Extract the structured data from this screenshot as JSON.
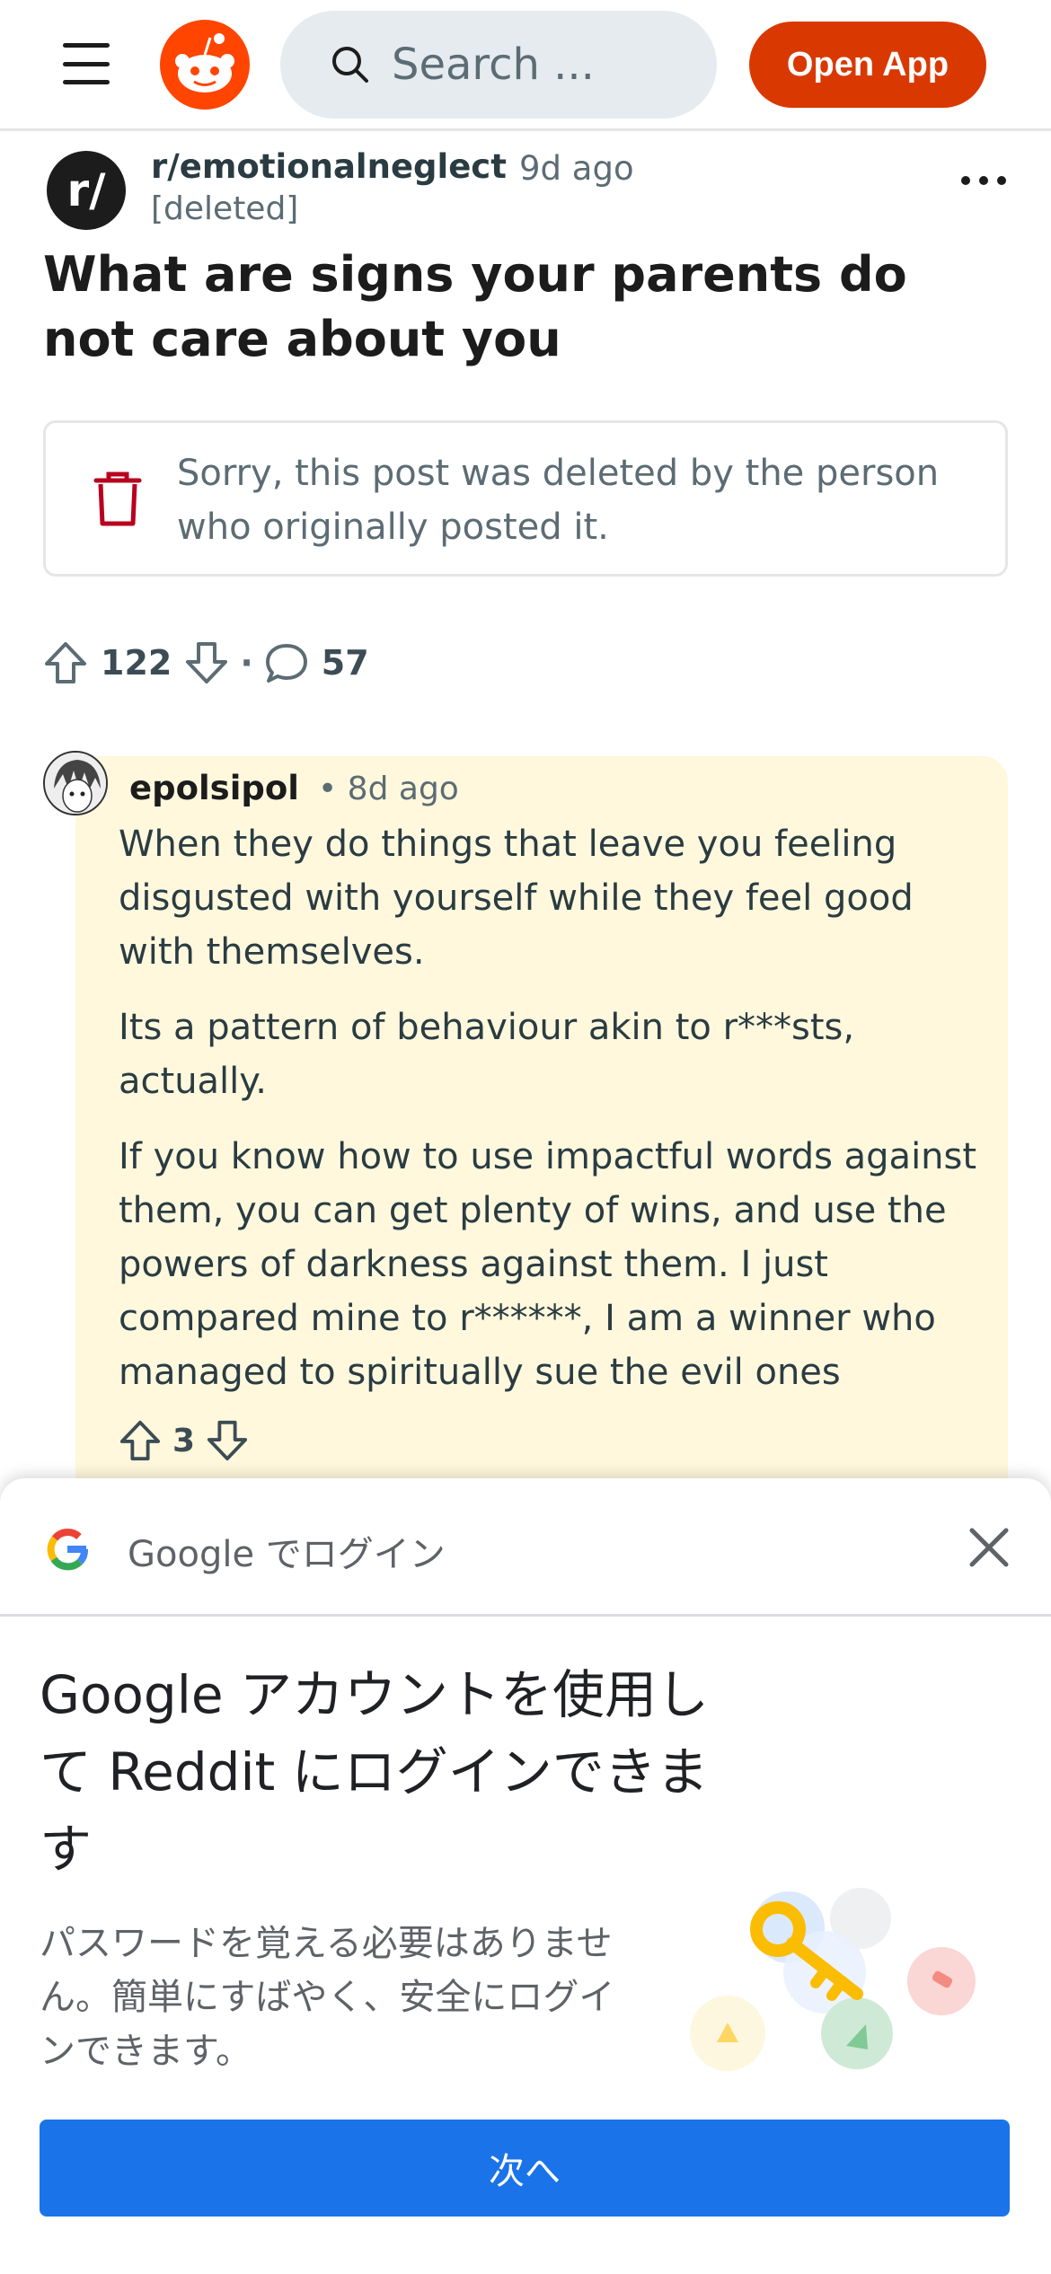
{
  "header": {
    "search_placeholder": "Search ...",
    "open_app_label": "Open App"
  },
  "post": {
    "subreddit_icon_text": "r/",
    "subreddit": "r/emotionalneglect",
    "age": "9d ago",
    "author": "[deleted]",
    "title": "What are signs your parents do not care about you",
    "deleted_notice": "Sorry, this post was deleted by the person who originally posted it.",
    "upvotes": "122",
    "separator": "·",
    "comments": "57"
  },
  "comment": {
    "username": "epolsipol",
    "age": "• 8d ago",
    "paragraphs": [
      "When they do things that leave you feeling disgusted with yourself while they feel good with themselves.",
      "Its a pattern of behaviour akin to r***sts, actually.",
      "If you know how to use impactful words against them, you can get plenty of wins, and use the powers of darkness against them. I just compared mine to r******, I am a winner who managed to spiritually sue the evil ones"
    ],
    "votes": "3"
  },
  "google_sheet": {
    "header_text": "Google でログイン",
    "title": "Google アカウントを使用して Reddit にログインできます",
    "description": "パスワードを覚える必要はありません。簡単にすばやく、安全にログインできます。",
    "next_label": "次へ"
  },
  "colors": {
    "reddit_orange": "#d93900",
    "comment_bg": "#fff8dd",
    "google_blue": "#1a73e8",
    "trash_red": "#b8001f"
  },
  "icons": [
    "menu-icon",
    "reddit-logo-icon",
    "search-icon",
    "more-icon",
    "trash-icon",
    "upvote-icon",
    "downvote-icon",
    "comment-icon",
    "google-logo-icon",
    "close-icon",
    "key-illustration-icon"
  ]
}
